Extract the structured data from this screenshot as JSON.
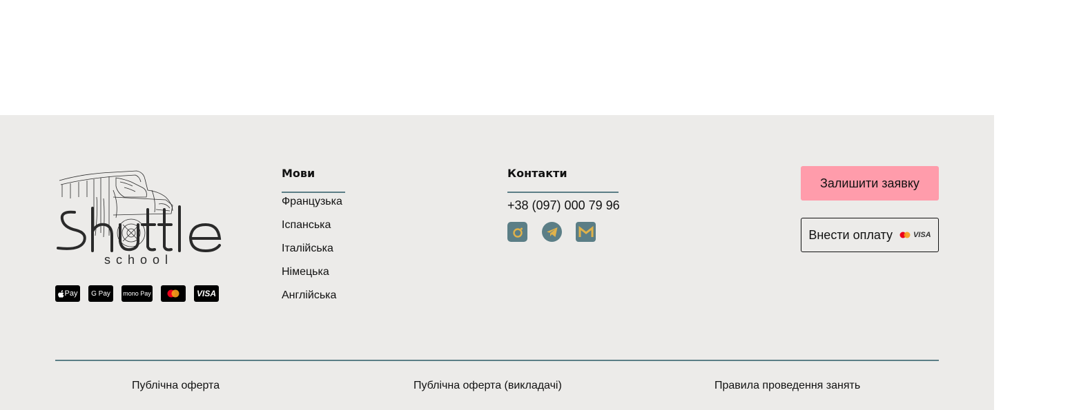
{
  "brand": {
    "logo_word": "Shuttle",
    "logo_sub": "school"
  },
  "payment_methods": [
    {
      "icon": "apple-pay-icon",
      "label": "Pay"
    },
    {
      "icon": "google-pay-icon",
      "label": "G Pay"
    },
    {
      "icon": "mono-pay-icon",
      "label": "mono Pay"
    },
    {
      "icon": "mastercard-icon",
      "label": ""
    },
    {
      "icon": "visa-icon",
      "label": "VISA"
    }
  ],
  "languages": {
    "title": "Мови",
    "items": [
      "Французька",
      "Іспанська",
      "Італійська",
      "Німецька",
      "Англійська"
    ]
  },
  "contacts": {
    "title": "Контакти",
    "phone": "+38 (097) 000 79 96",
    "social": [
      "instagram-icon",
      "telegram-icon",
      "gmail-icon"
    ]
  },
  "actions": {
    "request_label": "Залишити заявку",
    "pay_label": "Внести оплату",
    "pay_card_text": "VISA"
  },
  "legal": {
    "links": [
      "Публічна оферта",
      "Публічна оферта (викладачі)",
      "Правила проведення занять"
    ]
  },
  "colors": {
    "footer_bg": "#ECEBE9",
    "accent_rule": "#5B7E86",
    "request_button": "#FF9CAB",
    "social_bg": "#5B7E86",
    "social_fg": "#E0B24A"
  }
}
